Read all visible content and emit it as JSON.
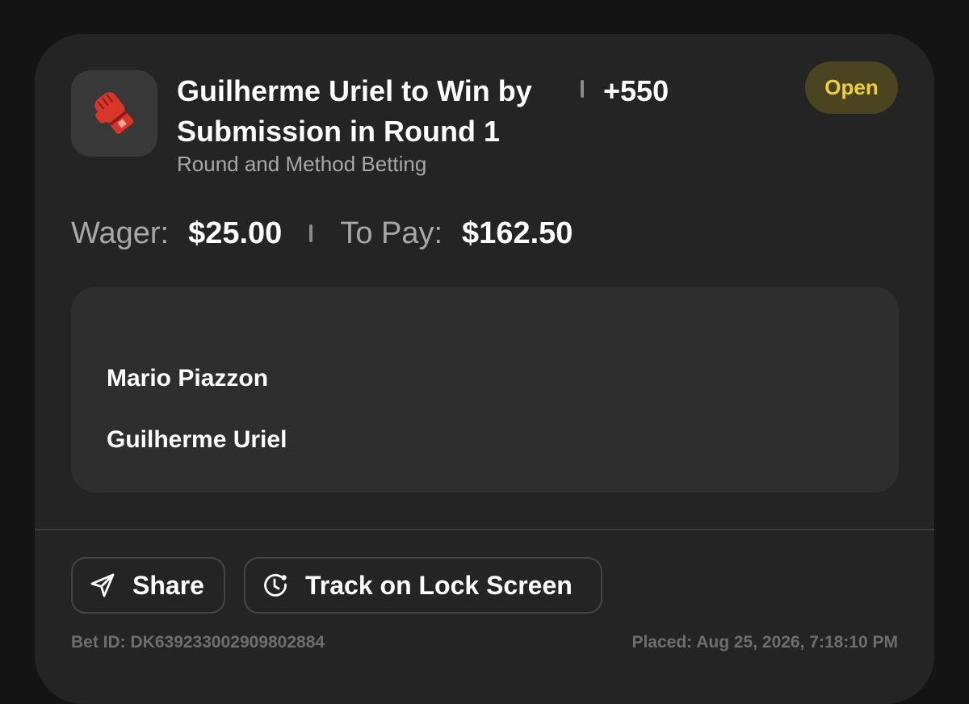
{
  "bet": {
    "title": "Guilherme Uriel to Win by Submission in Round 1",
    "odds": "+550",
    "market": "Round and Method Betting",
    "status": "Open",
    "sport_icon": "mma-glove-icon"
  },
  "money": {
    "wager_label": "Wager:",
    "wager_value": "$25.00",
    "topay_label": "To Pay:",
    "topay_value": "$162.50"
  },
  "matchup": {
    "fighters": [
      "Mario Piazzon",
      "Guilherme Uriel"
    ]
  },
  "actions": {
    "share_label": "Share",
    "share_icon": "send-icon",
    "track_label": "Track on Lock Screen",
    "track_icon": "lock-screen-tracker-icon"
  },
  "footer": {
    "bet_id": "Bet ID: DK639233002909802884",
    "placed": "Placed: Aug 25, 2026, 7:18:10 PM"
  },
  "colors": {
    "background": "#141414",
    "card": "#242424",
    "status_text": "#f2cd3c",
    "status_bg": "#4a4420",
    "glove": "#d9362b"
  }
}
